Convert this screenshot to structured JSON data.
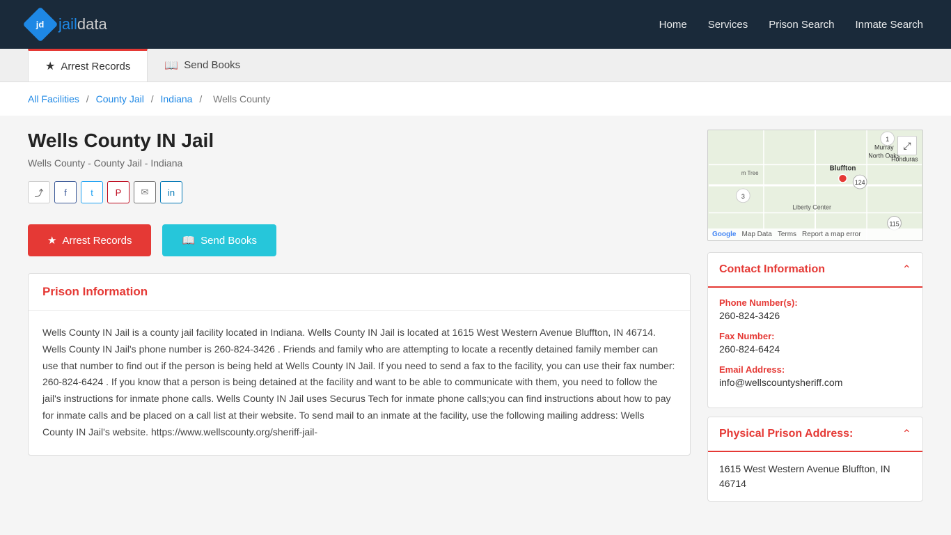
{
  "header": {
    "logo_text_jd": "jail",
    "logo_text_data": "data",
    "nav": {
      "home": "Home",
      "services": "Services",
      "prison_search": "Prison Search",
      "inmate_search": "Inmate Search"
    }
  },
  "tabs": {
    "arrest_records": "Arrest Records",
    "send_books": "Send Books"
  },
  "breadcrumb": {
    "all_facilities": "All Facilities",
    "county_jail": "County Jail",
    "indiana": "Indiana",
    "current": "Wells County"
  },
  "main": {
    "title": "Wells County IN Jail",
    "subtitle": "Wells County - County Jail - Indiana"
  },
  "action_buttons": {
    "arrest_records": "Arrest Records",
    "send_books": "Send Books"
  },
  "prison_info": {
    "section_title": "Prison Information",
    "description": "Wells County IN Jail is a county jail facility located in Indiana. Wells County IN Jail is located at 1615 West Western Avenue Bluffton, IN 46714. Wells County IN Jail's phone number is 260-824-3426 . Friends and family who are attempting to locate a recently detained family member can use that number to find out if the person is being held at Wells County IN Jail. If you need to send a fax to the facility, you can use their fax number: 260-824-6424 . If you know that a person is being detained at the facility and want to be able to communicate with them, you need to follow the jail's instructions for inmate phone calls. Wells County IN Jail uses Securus Tech for inmate phone calls;you can find instructions about how to pay for inmate calls and be placed on a call list at their website. To send mail to an inmate at the facility, use the following mailing address:  Wells County IN Jail's website. https://www.wellscounty.org/sheriff-jail-"
  },
  "contact_info": {
    "section_title": "Contact Information",
    "phone_label": "Phone Number(s):",
    "phone_value": "260-824-3426",
    "fax_label": "Fax Number:",
    "fax_value": "260-824-6424",
    "email_label": "Email Address:",
    "email_value": "info@wellscountysheriff.com"
  },
  "physical_address": {
    "section_title": "Physical Prison Address:",
    "address": "1615 West Western Avenue Bluffton, IN 46714"
  },
  "map": {
    "terms": "Terms",
    "map_data": "Map Data",
    "report": "Report a map error"
  }
}
